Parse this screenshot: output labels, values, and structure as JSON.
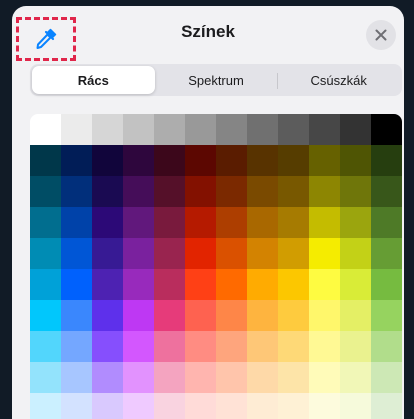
{
  "header": {
    "title": "Színek",
    "eyedropper_icon": "eyedropper-icon",
    "close_icon": "close-icon"
  },
  "tabs": [
    {
      "label": "Rács",
      "active": true
    },
    {
      "label": "Spektrum",
      "active": false
    },
    {
      "label": "Csúszkák",
      "active": false
    }
  ],
  "colors": {
    "accent": "#0a84ff",
    "highlight": "#e0264a"
  },
  "swatches": [
    [
      "#ffffff",
      "#ebebeb",
      "#d6d6d6",
      "#c2c2c2",
      "#adadad",
      "#999999",
      "#858585",
      "#707070",
      "#5c5c5c",
      "#474747",
      "#333333",
      "#000000"
    ],
    [
      "#00374a",
      "#011d57",
      "#11053b",
      "#2e063d",
      "#3c071b",
      "#5c0701",
      "#5a1c00",
      "#583300",
      "#563d00",
      "#666100",
      "#4f5504",
      "#263e0f"
    ],
    [
      "#004d65",
      "#012f7b",
      "#1a0a52",
      "#450d59",
      "#551029",
      "#831100",
      "#7b2900",
      "#7a4a00",
      "#785800",
      "#8d8602",
      "#6f760a",
      "#38571a"
    ],
    [
      "#016e8f",
      "#0042a9",
      "#2c0977",
      "#61187c",
      "#791a3d",
      "#b51a00",
      "#ad3e00",
      "#a96800",
      "#a67b01",
      "#c4bc00",
      "#9ba50e",
      "#4e7a27"
    ],
    [
      "#008cb4",
      "#0056d6",
      "#371a94",
      "#7a219e",
      "#99244f",
      "#e22400",
      "#da5100",
      "#d38301",
      "#d19d01",
      "#f5ec00",
      "#c3d117",
      "#669d34"
    ],
    [
      "#00a1d8",
      "#0061fd",
      "#4d22b2",
      "#982abc",
      "#b92d5d",
      "#ff4015",
      "#ff6a00",
      "#ffab01",
      "#fcc700",
      "#fefb41",
      "#d9ec37",
      "#76bb40"
    ],
    [
      "#01c7fc",
      "#3a87fd",
      "#5e30eb",
      "#be38f3",
      "#e63b7a",
      "#fe6250",
      "#fe8648",
      "#feb43f",
      "#fecb3e",
      "#fff76b",
      "#e4ef65",
      "#96d35f"
    ],
    [
      "#52d6fc",
      "#74a7ff",
      "#864ffd",
      "#d357fe",
      "#ee719e",
      "#ff8c82",
      "#fea57d",
      "#fec777",
      "#fed977",
      "#fff994",
      "#eaf28f",
      "#b1dd8b"
    ],
    [
      "#93e3fc",
      "#a7c6ff",
      "#b18cfe",
      "#e292fe",
      "#f4a4c0",
      "#ffb5af",
      "#ffc5ab",
      "#fed9a8",
      "#fde4a8",
      "#fffbb9",
      "#f1f7b7",
      "#cde8b5"
    ],
    [
      "#cbf0ff",
      "#d3e2ff",
      "#d9c9fe",
      "#efcaff",
      "#f9d3e0",
      "#ffdbd8",
      "#ffe2d6",
      "#feecd4",
      "#fef1d5",
      "#fdfbdd",
      "#f6fadb",
      "#deeed4"
    ]
  ]
}
